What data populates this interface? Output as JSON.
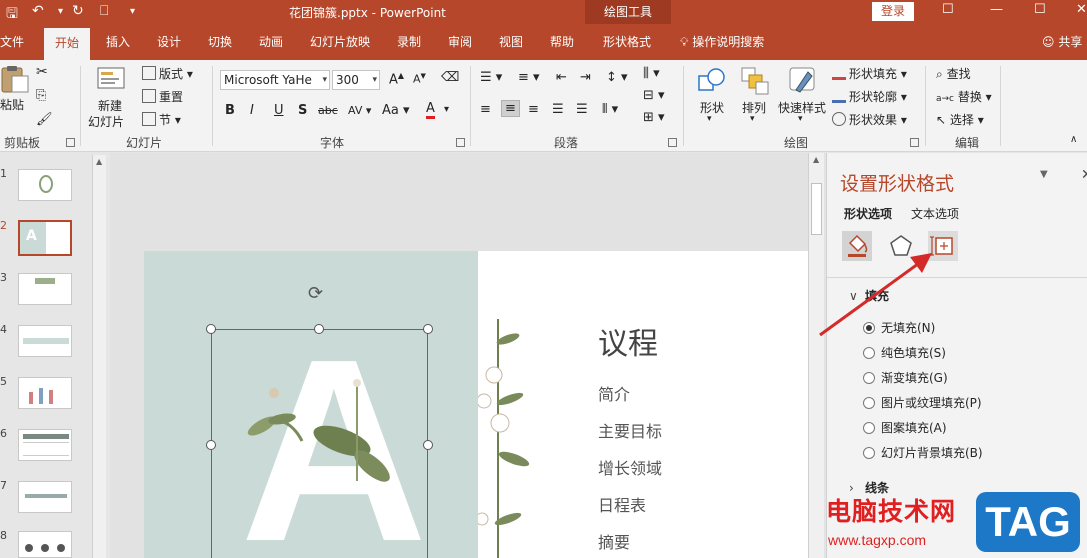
{
  "titlebar": {
    "doc_title": "花团锦簇.pptx  -  PowerPoint",
    "contextual_tools": "绘图工具",
    "login": "登录"
  },
  "tabs": [
    {
      "label": "文件",
      "active": false
    },
    {
      "label": "开始",
      "active": true
    },
    {
      "label": "插入",
      "active": false
    },
    {
      "label": "设计",
      "active": false
    },
    {
      "label": "切换",
      "active": false
    },
    {
      "label": "动画",
      "active": false
    },
    {
      "label": "幻灯片放映",
      "active": false
    },
    {
      "label": "录制",
      "active": false
    },
    {
      "label": "审阅",
      "active": false
    },
    {
      "label": "视图",
      "active": false
    },
    {
      "label": "帮助",
      "active": false
    },
    {
      "label": "形状格式",
      "active": false
    }
  ],
  "tell_me": "操作说明搜索",
  "share": "共享",
  "ribbon": {
    "clipboard": {
      "paste": "粘贴",
      "label": "剪贴板"
    },
    "slides": {
      "new_slide_1": "新建",
      "new_slide_2": "幻灯片",
      "layout": "版式",
      "reset": "重置",
      "section": "节",
      "label": "幻灯片"
    },
    "font": {
      "name": "Microsoft YaHe",
      "size": "300",
      "bold": "B",
      "italic": "I",
      "underline": "U",
      "shadow": "S",
      "strike": "abc",
      "spacing": "AV",
      "case": "Aa",
      "color": "A",
      "grow": "A",
      "shrink": "A",
      "label": "字体"
    },
    "paragraph": {
      "label": "段落"
    },
    "drawing": {
      "shapes": "形状",
      "arrange": "排列",
      "quick_styles": "快速样式",
      "fill": "形状填充",
      "outline": "形状轮廓",
      "effects": "形状效果",
      "label": "绘图"
    },
    "editing": {
      "find": "查找",
      "replace": "替换",
      "select": "选择",
      "label": "编辑"
    }
  },
  "thumbnails": [
    {
      "num": "1",
      "active": false
    },
    {
      "num": "2",
      "active": true
    },
    {
      "num": "3",
      "active": false
    },
    {
      "num": "4",
      "active": false
    },
    {
      "num": "5",
      "active": false
    },
    {
      "num": "6",
      "active": false
    },
    {
      "num": "7",
      "active": false
    },
    {
      "num": "8",
      "active": false
    }
  ],
  "slide": {
    "big_letter": "A",
    "agenda_title": "议程",
    "agenda_items": [
      "简介",
      "主要目标",
      "增长领域",
      "日程表",
      "摘要"
    ]
  },
  "pane": {
    "title": "设置形状格式",
    "subtabs": [
      {
        "label": "形状选项",
        "active": true
      },
      {
        "label": "文本选项",
        "active": false
      }
    ],
    "fill_section": "填充",
    "fill_options": [
      {
        "label": "无填充(N)",
        "checked": true
      },
      {
        "label": "纯色填充(S)",
        "checked": false
      },
      {
        "label": "渐变填充(G)",
        "checked": false
      },
      {
        "label": "图片或纹理填充(P)",
        "checked": false
      },
      {
        "label": "图案填充(A)",
        "checked": false
      },
      {
        "label": "幻灯片背景填充(B)",
        "checked": false
      }
    ],
    "line_section": "线条"
  },
  "watermark": {
    "cn": "电脑技术网",
    "url": "www.tagxp.com",
    "tag": "TAG"
  },
  "colors": {
    "accent": "#b7472a",
    "slide_panel": "#c9dad7",
    "arrow": "#d42a2a"
  }
}
